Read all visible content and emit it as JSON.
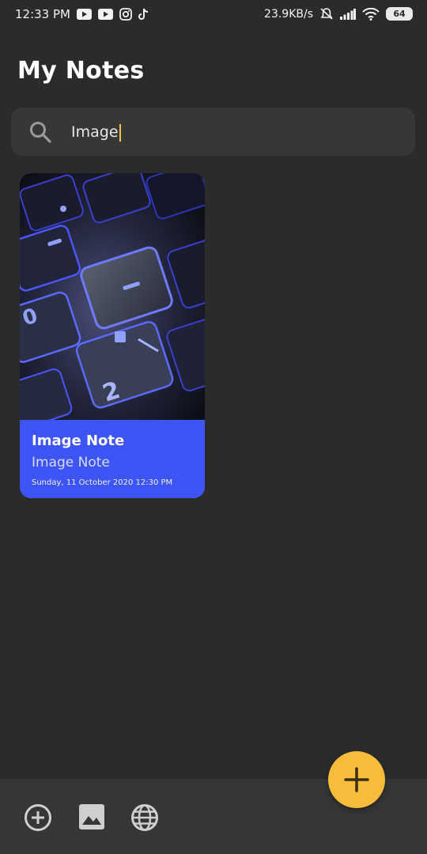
{
  "status_bar": {
    "time": "12:33 PM",
    "net_speed": "23.9KB/s",
    "battery": "64",
    "left_icons": [
      "youtube-icon",
      "youtube-icon",
      "instagram-icon",
      "tiktok-icon"
    ],
    "right_icons": [
      "mute-bell-icon",
      "signal-icon",
      "wifi-icon",
      "battery-icon"
    ]
  },
  "header": {
    "title": "My Notes"
  },
  "search": {
    "value": "Image",
    "icon": "search-icon"
  },
  "notes": [
    {
      "title": "Image Note",
      "subtitle": "Image Note",
      "date": "Sunday, 11 October 2020 12:30 PM",
      "color": "#3d54f6"
    }
  ],
  "bottom_bar": {
    "icons": [
      "add-circle-icon",
      "image-icon",
      "globe-icon"
    ]
  },
  "fab": {
    "icon": "plus-icon",
    "color": "#f7bd3a"
  },
  "colors": {
    "background": "#2b2b2b",
    "search_bg": "#373737",
    "accent": "#f7bd3a",
    "card": "#3d54f6"
  }
}
